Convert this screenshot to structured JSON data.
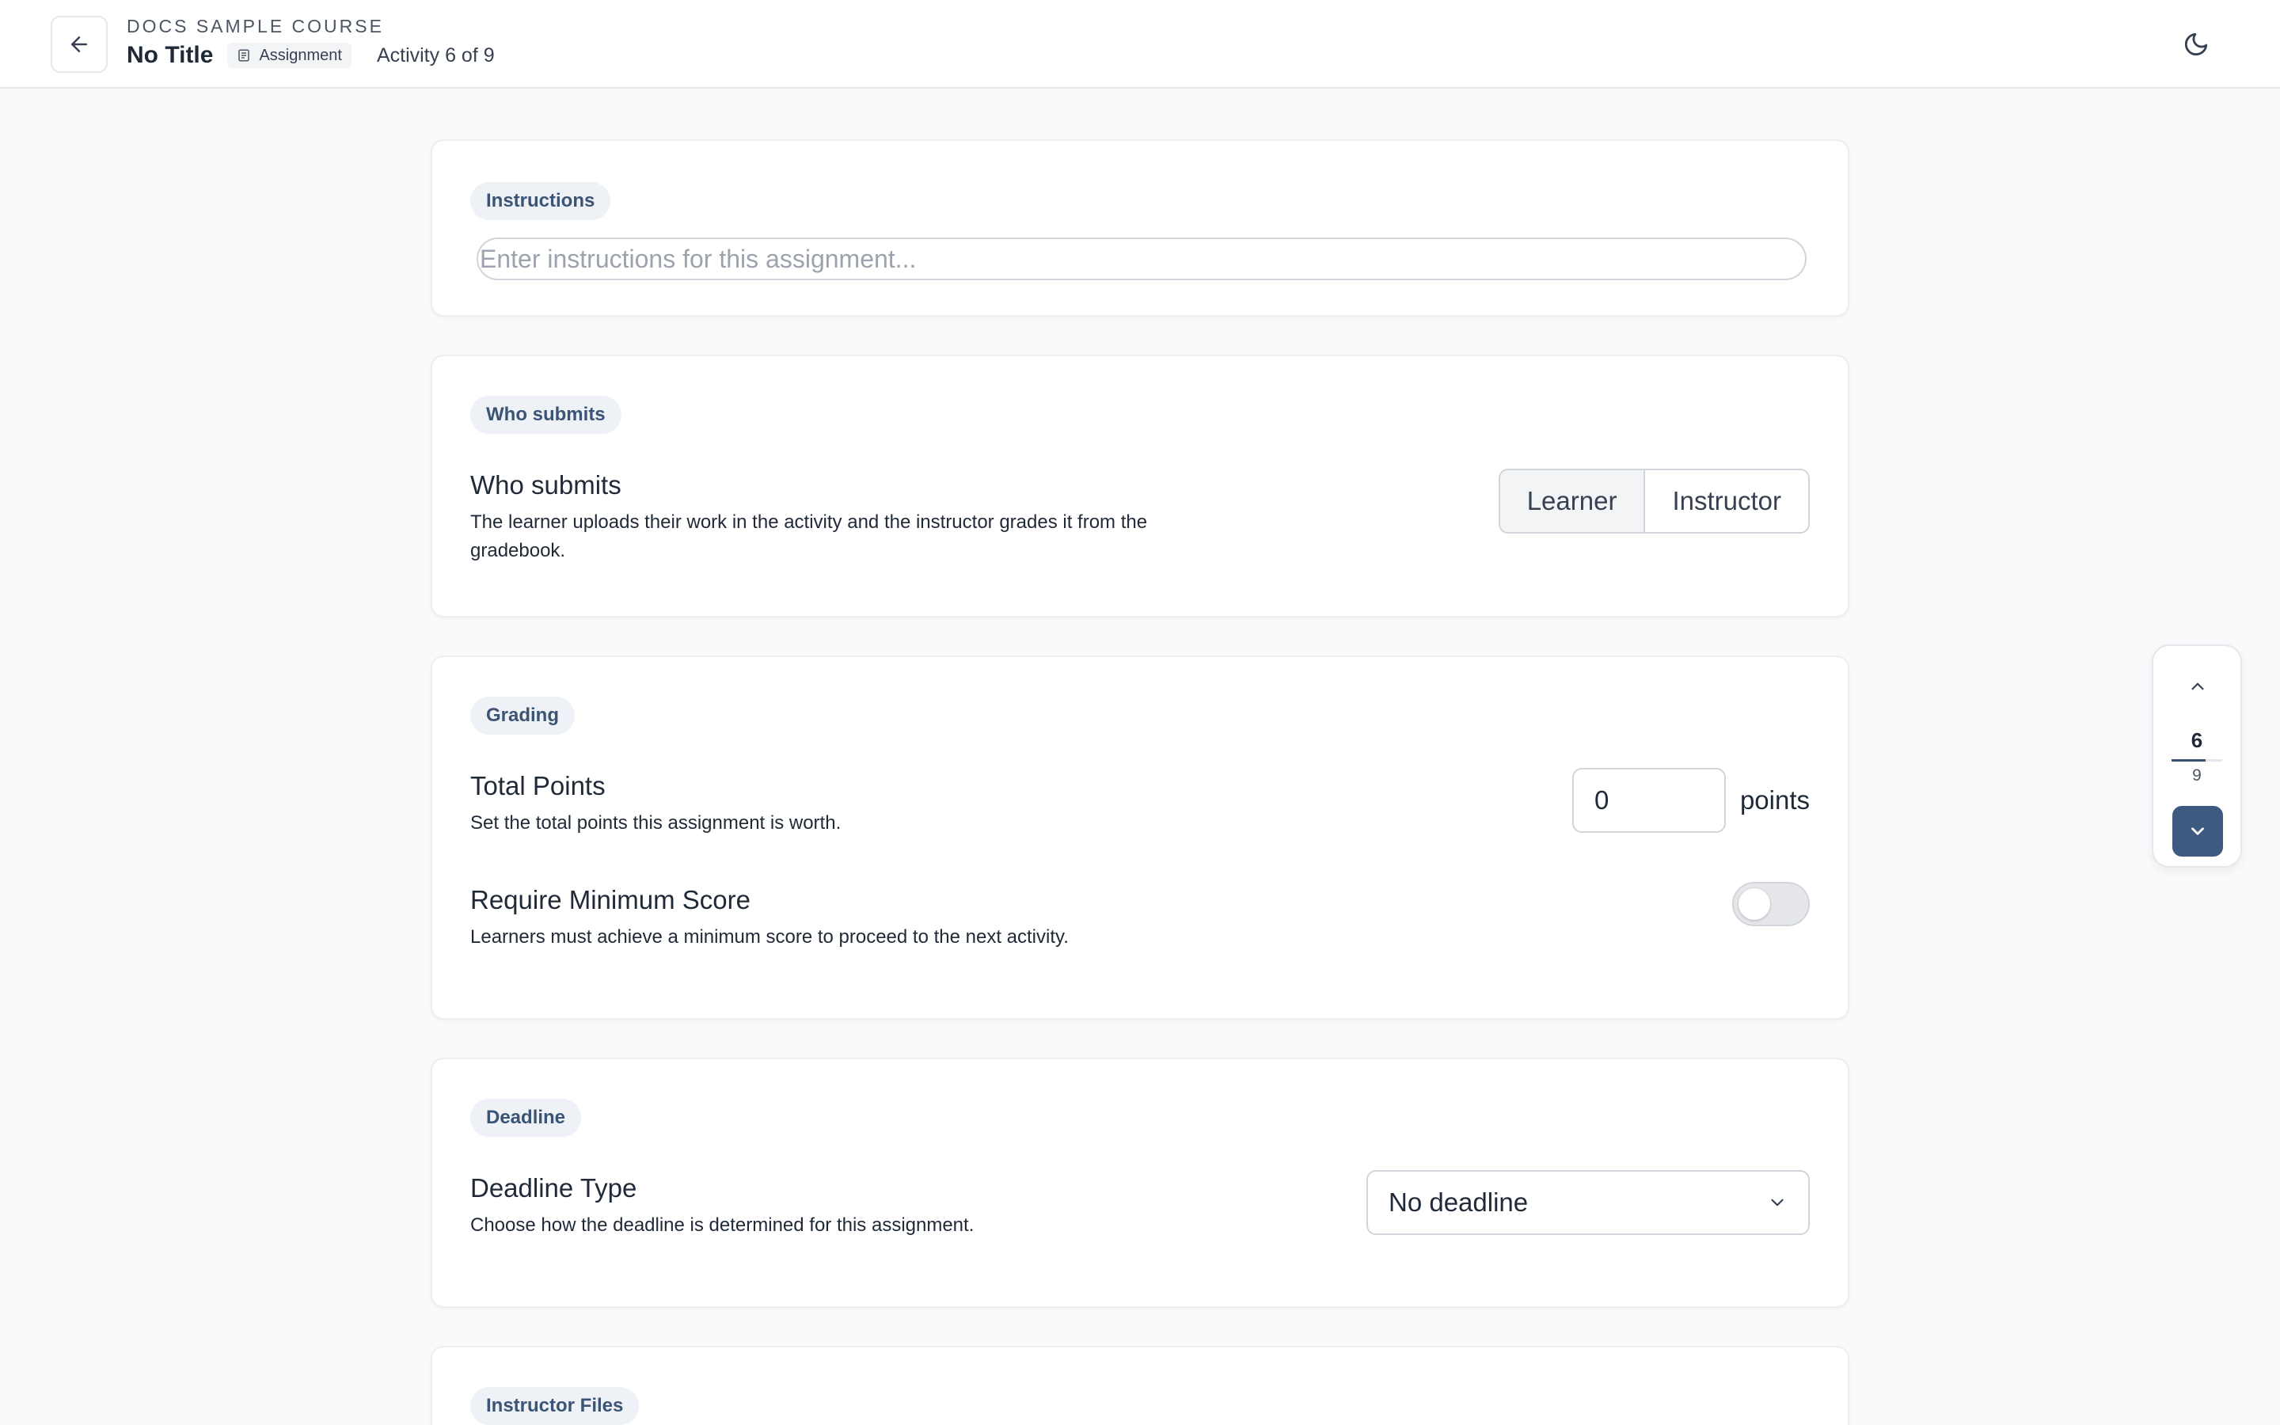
{
  "header": {
    "course_name": "DOCS SAMPLE COURSE",
    "title": "No Title",
    "type_badge": "Assignment",
    "activity_count": "Activity 6 of 9",
    "back_icon": "arrow-left-icon",
    "theme_icon": "moon-icon",
    "badge_icon": "document-icon"
  },
  "instructions": {
    "section_label": "Instructions",
    "placeholder": "Enter instructions for this assignment...",
    "value": ""
  },
  "who_submits": {
    "section_label": "Who submits",
    "title": "Who submits",
    "description": "The learner uploads their work in the activity and the instructor grades it from the gradebook.",
    "options": [
      "Learner",
      "Instructor"
    ],
    "selected": "Learner"
  },
  "grading": {
    "section_label": "Grading",
    "total_points_title": "Total Points",
    "total_points_desc": "Set the total points this assignment is worth.",
    "total_points_value": "0",
    "points_unit": "points",
    "min_score_title": "Require Minimum Score",
    "min_score_desc": "Learners must achieve a minimum score to proceed to the next activity.",
    "min_score_enabled": false
  },
  "deadline": {
    "section_label": "Deadline",
    "title": "Deadline Type",
    "description": "Choose how the deadline is determined for this assignment.",
    "selected": "No deadline"
  },
  "instructor_files": {
    "section_label": "Instructor Files"
  },
  "pager": {
    "current": "6",
    "total": "9",
    "progress": 0.67
  },
  "colors": {
    "accent": "#3d5a80",
    "pill_bg": "#eef1f5",
    "pill_text": "#3b5475",
    "page_bg": "#f9fafb"
  }
}
